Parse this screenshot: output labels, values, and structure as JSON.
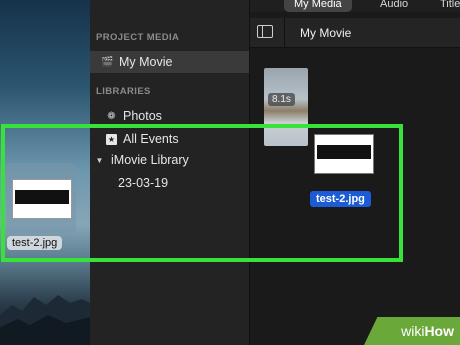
{
  "tabs": [
    {
      "label": "My Media"
    },
    {
      "label": "Audio"
    },
    {
      "label": "Title"
    }
  ],
  "sidebar": {
    "project_media_header": "PROJECT MEDIA",
    "project_item": "My Movie",
    "libraries_header": "LIBRARIES",
    "photos_item": "Photos",
    "all_events_item": "All Events",
    "library_item": "iMovie Library",
    "event_item": "23-03-19"
  },
  "browser": {
    "title": "My Movie",
    "clip_duration": "8.1s",
    "dragged_file_label": "test-2.jpg"
  },
  "desktop": {
    "file_label": "test-2.jpg"
  },
  "watermark": {
    "prefix": "wiki",
    "suffix": "How"
  },
  "colors": {
    "highlight": "#39e23a",
    "selection_blue": "#1c5bd6",
    "watermark_green": "#6aa83a"
  }
}
